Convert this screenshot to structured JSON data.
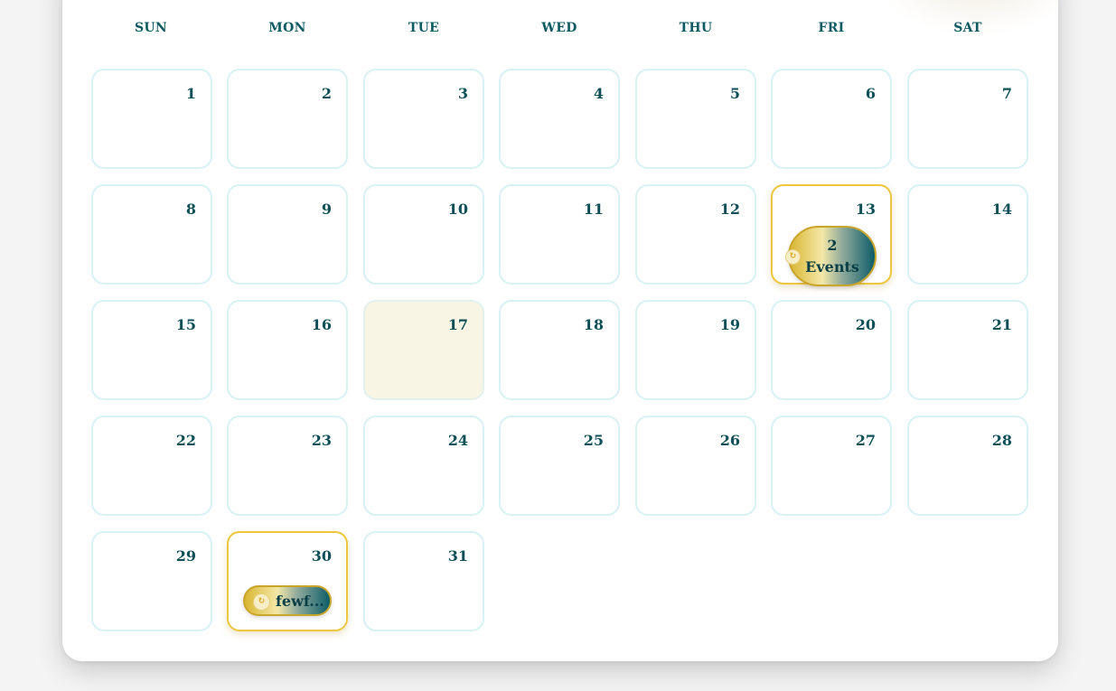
{
  "calendar": {
    "weekdays": [
      "SUN",
      "MON",
      "TUE",
      "WED",
      "THU",
      "FRI",
      "SAT"
    ],
    "days": [
      {
        "day": "1"
      },
      {
        "day": "2"
      },
      {
        "day": "3"
      },
      {
        "day": "4"
      },
      {
        "day": "5"
      },
      {
        "day": "6"
      },
      {
        "day": "7"
      },
      {
        "day": "8"
      },
      {
        "day": "9"
      },
      {
        "day": "10"
      },
      {
        "day": "11"
      },
      {
        "day": "12"
      },
      {
        "day": "13",
        "event_label": "2 Events",
        "event_icon": "clock-icon"
      },
      {
        "day": "14"
      },
      {
        "day": "15"
      },
      {
        "day": "16"
      },
      {
        "day": "17",
        "is_today": true
      },
      {
        "day": "18"
      },
      {
        "day": "19"
      },
      {
        "day": "20"
      },
      {
        "day": "21"
      },
      {
        "day": "22"
      },
      {
        "day": "23"
      },
      {
        "day": "24"
      },
      {
        "day": "25"
      },
      {
        "day": "26"
      },
      {
        "day": "27"
      },
      {
        "day": "28"
      },
      {
        "day": "29"
      },
      {
        "day": "30",
        "event_label": "fewf...",
        "event_icon": "clock-icon"
      },
      {
        "day": "31"
      }
    ],
    "colors": {
      "accent_gold": "#edc73e",
      "accent_teal": "#0d5d68",
      "cell_border": "#d7f1f4",
      "today_bg": "#f8f5e4",
      "text": "#0e4f58"
    }
  }
}
